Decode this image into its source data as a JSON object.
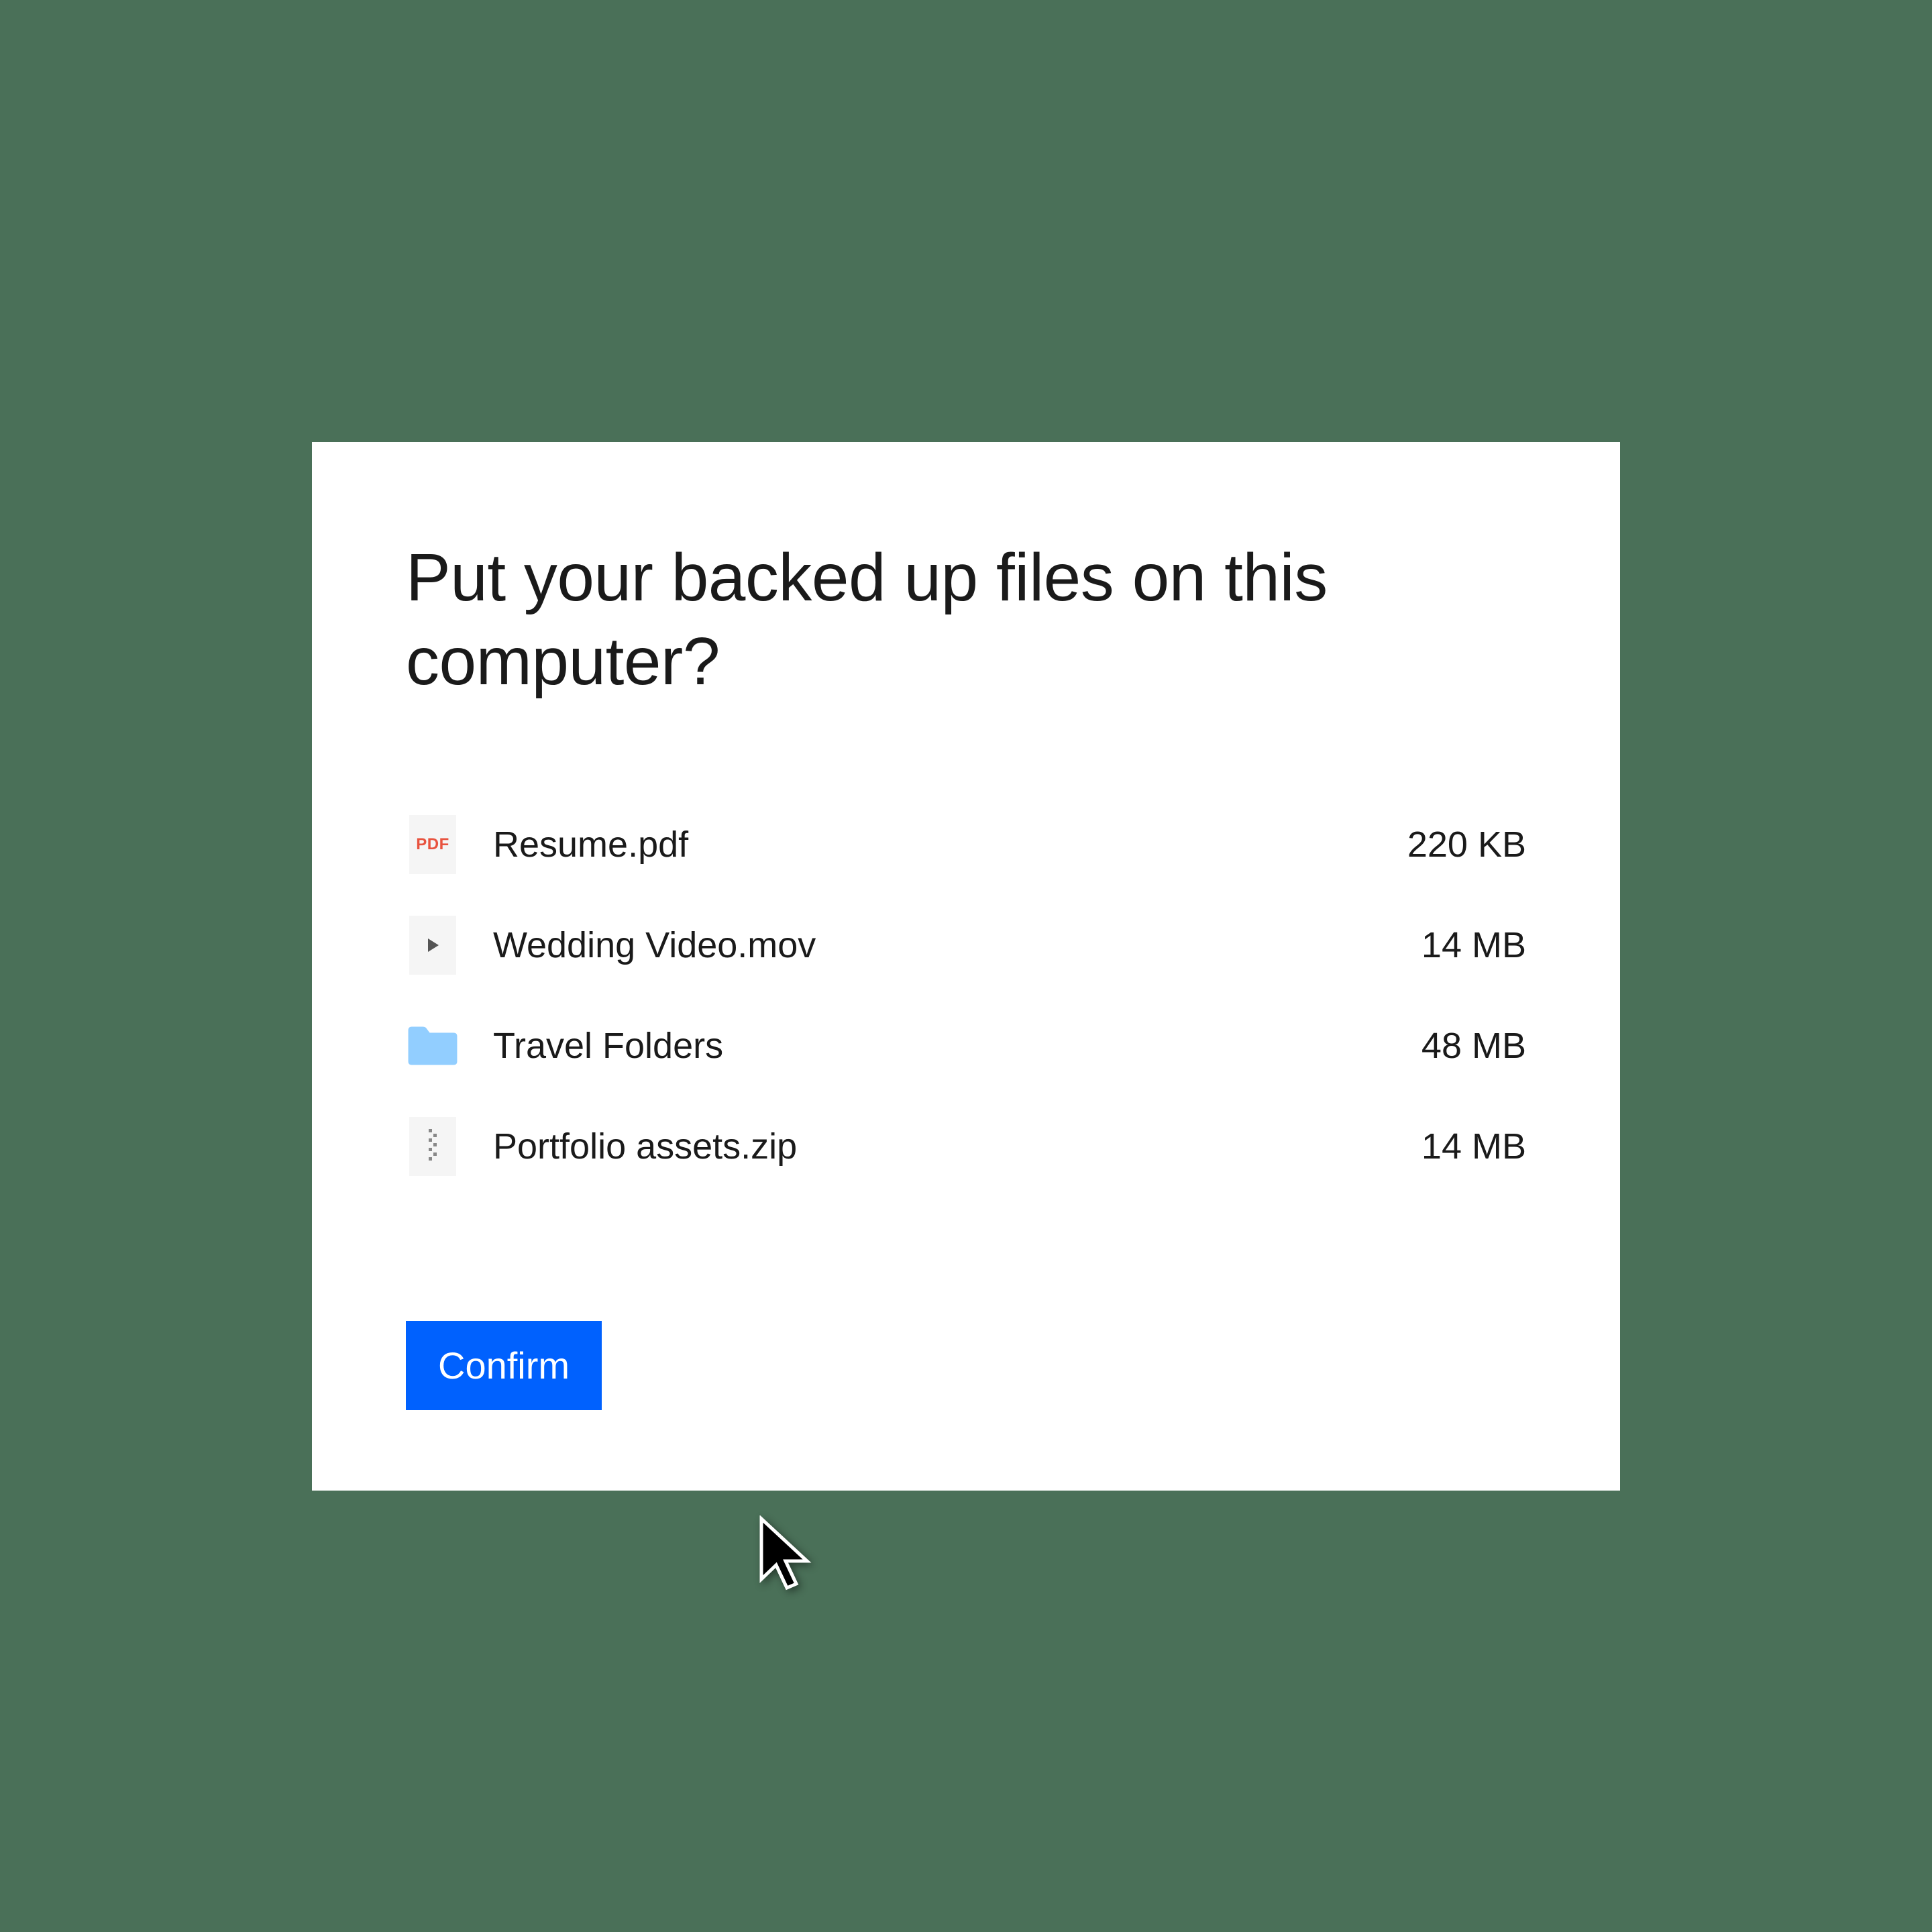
{
  "dialog": {
    "title": "Put your backed up files on this computer?"
  },
  "files": [
    {
      "name": "Resume.pdf",
      "size": "220 KB",
      "icon": "pdf"
    },
    {
      "name": "Wedding Video.mov",
      "size": "14 MB",
      "icon": "video"
    },
    {
      "name": "Travel Folders",
      "size": "48 MB",
      "icon": "folder"
    },
    {
      "name": "Portfolio assets.zip",
      "size": "14 MB",
      "icon": "zip"
    }
  ],
  "actions": {
    "confirm_label": "Confirm"
  }
}
